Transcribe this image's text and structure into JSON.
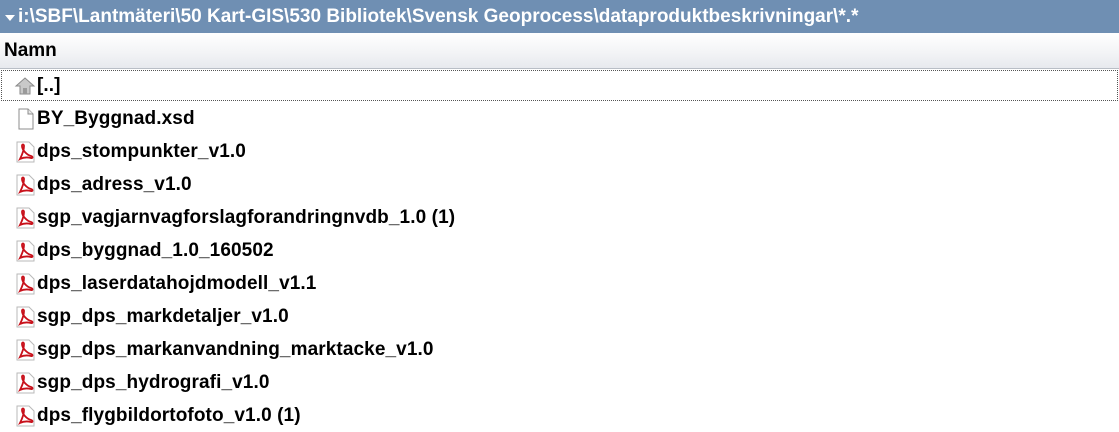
{
  "path_bar": {
    "text": "i:\\SBF\\Lantmäteri\\50 Kart-GIS\\530 Bibliotek\\Svensk Geoprocess\\dataproduktbeskrivningar\\*.*"
  },
  "columns": {
    "name_header": "Namn"
  },
  "files": [
    {
      "name": "[..]",
      "icon": "parent-folder-icon"
    },
    {
      "name": "BY_Byggnad.xsd",
      "icon": "document-icon"
    },
    {
      "name": "dps_stompunkter_v1.0",
      "icon": "pdf-icon"
    },
    {
      "name": "dps_adress_v1.0",
      "icon": "pdf-icon"
    },
    {
      "name": "sgp_vagjarnvagforslagforandringnvdb_1.0 (1)",
      "icon": "pdf-icon"
    },
    {
      "name": "dps_byggnad_1.0_160502",
      "icon": "pdf-icon"
    },
    {
      "name": "dps_laserdatahojdmodell_v1.1",
      "icon": "pdf-icon"
    },
    {
      "name": "sgp_dps_markdetaljer_v1.0",
      "icon": "pdf-icon"
    },
    {
      "name": "sgp_dps_markanvandning_marktacke_v1.0",
      "icon": "pdf-icon"
    },
    {
      "name": "sgp_dps_hydrografi_v1.0",
      "icon": "pdf-icon"
    },
    {
      "name": "dps_flygbildortofoto_v1.0 (1)",
      "icon": "pdf-icon"
    }
  ],
  "colors": {
    "path_bar_background": "#6f8fb3",
    "pdf_icon_red": "#c8101a"
  }
}
